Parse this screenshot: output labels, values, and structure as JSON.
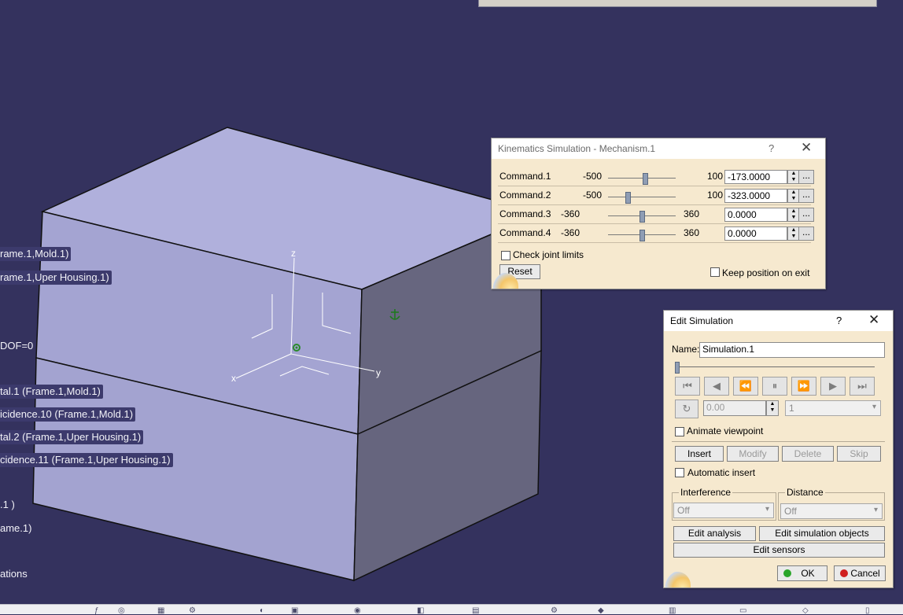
{
  "viewport": {
    "tree_labels": [
      "rame.1,Mold.1)",
      "rame.1,Uper Housing.1)",
      "tal.1 (Frame.1,Mold.1)",
      "icidence.10 (Frame.1,Mold.1)",
      "tal.2 (Frame.1,Uper Housing.1)",
      "cidence.11 (Frame.1,Uper Housing.1)"
    ],
    "tree_plain": [
      "DOF=0",
      ".1 )",
      "ame.1)",
      "ations"
    ],
    "axis": {
      "z": "z",
      "y": "y",
      "x": "x"
    }
  },
  "kinematics": {
    "title": "Kinematics Simulation - Mechanism.1",
    "help": "?",
    "close": "✕",
    "commands": [
      {
        "name": "Command.1",
        "min": "-500",
        "max": "100",
        "value": "-173.0000",
        "fraction": 0.55
      },
      {
        "name": "Command.2",
        "min": "-500",
        "max": "100",
        "value": "-323.0000",
        "fraction": 0.29
      },
      {
        "name": "Command.3",
        "min": "-360",
        "max": "360",
        "value": "0.0000",
        "fraction": 0.5
      },
      {
        "name": "Command.4",
        "min": "-360",
        "max": "360",
        "value": "0.0000",
        "fraction": 0.5
      }
    ],
    "more": "...",
    "check_joint_limits": "Check joint limits",
    "reset": "Reset",
    "keep_position": "Keep position on exit"
  },
  "edit_sim": {
    "title": "Edit Simulation",
    "help": "?",
    "close": "✕",
    "name_label": "Name:",
    "name_value": "Simulation.1",
    "timeline_fraction": 0.0,
    "step_value": "0.00",
    "step_combo": "1",
    "animate_viewpoint": "Animate viewpoint",
    "insert": "Insert",
    "modify": "Modify",
    "delete": "Delete",
    "skip": "Skip",
    "automatic_insert": "Automatic insert",
    "interference_label": "Interference",
    "interference_value": "Off",
    "distance_label": "Distance",
    "distance_value": "Off",
    "edit_analysis": "Edit analysis",
    "edit_sim_objects": "Edit simulation objects",
    "edit_sensors": "Edit sensors",
    "ok": "OK",
    "cancel": "Cancel"
  },
  "colors": {
    "background": "#34325e",
    "box_top": "#b0b0dc",
    "box_front": "#a4a4d2",
    "box_side": "#67667f",
    "dialog": "#f6e9cf"
  }
}
